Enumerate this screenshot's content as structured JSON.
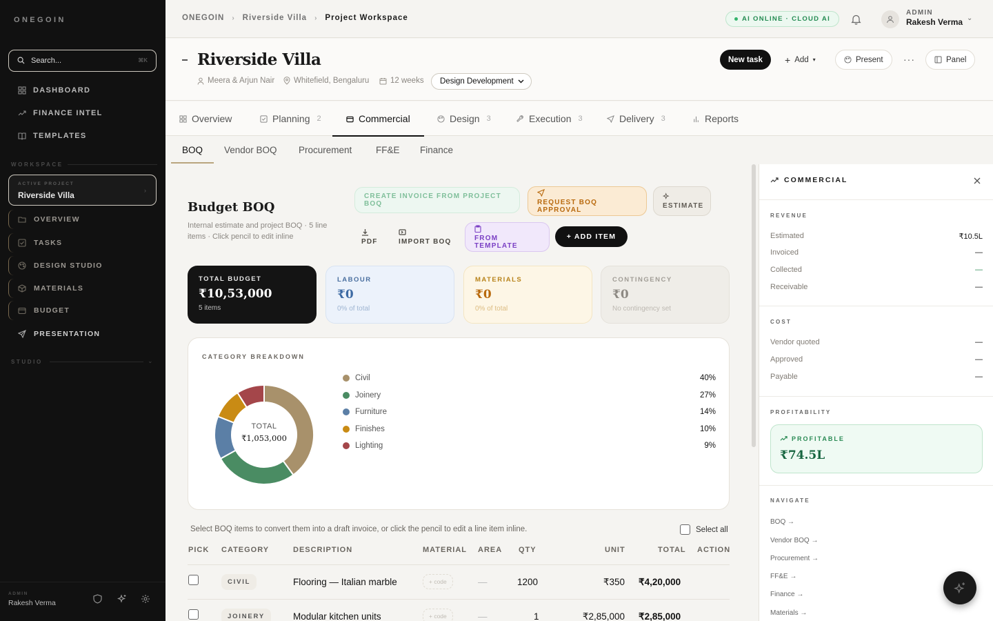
{
  "sidebar": {
    "brand": "ONEGOIN",
    "search_placeholder": "Search...",
    "search_shortcut": "⌘K",
    "top_nav": [
      {
        "label": "DASHBOARD",
        "icon": "grid-icon"
      },
      {
        "label": "FINANCE INTEL",
        "icon": "trend-icon"
      },
      {
        "label": "TEMPLATES",
        "icon": "book-icon"
      }
    ],
    "workspace_label": "WORKSPACE",
    "active_project_label": "ACTIVE PROJECT",
    "active_project": "Riverside Villa",
    "project_nav": [
      {
        "label": "OVERVIEW",
        "icon": "folder-icon"
      },
      {
        "label": "TASKS",
        "icon": "check-square-icon"
      },
      {
        "label": "DESIGN STUDIO",
        "icon": "palette-icon"
      },
      {
        "label": "MATERIALS",
        "icon": "box-icon"
      },
      {
        "label": "BUDGET",
        "icon": "wallet-icon"
      },
      {
        "label": "PRESENTATION",
        "icon": "send-icon"
      }
    ],
    "studio_label": "STUDIO",
    "footer": {
      "role": "ADMIN",
      "name": "Rakesh Verma"
    }
  },
  "header": {
    "breadcrumb": [
      "ONEGOIN",
      "Riverside Villa",
      "Project Workspace"
    ],
    "ai_status": "AI ONLINE · CLOUD AI",
    "user_role": "ADMIN",
    "user_name": "Rakesh Verma"
  },
  "project": {
    "title": "Riverside Villa",
    "client": "Meera & Arjun Nair",
    "location": "Whitefield, Bengaluru",
    "duration": "12 weeks",
    "phase": "Design Development",
    "actions": {
      "new_task": "New task",
      "add": "Add",
      "present": "Present",
      "panel": "Panel"
    }
  },
  "tabs": [
    {
      "label": "Overview",
      "count": ""
    },
    {
      "label": "Planning",
      "count": "2"
    },
    {
      "label": "Commercial",
      "count": ""
    },
    {
      "label": "Design",
      "count": "3"
    },
    {
      "label": "Execution",
      "count": "3"
    },
    {
      "label": "Delivery",
      "count": "3"
    },
    {
      "label": "Reports",
      "count": ""
    }
  ],
  "subtabs": [
    "BOQ",
    "Vendor BOQ",
    "Procurement",
    "FF&E",
    "Finance"
  ],
  "boq": {
    "title": "Budget BOQ",
    "description": "Internal estimate and project BOQ · 5 line items · Click pencil to edit inline",
    "actions": {
      "create_invoice": "CREATE INVOICE FROM PROJECT BOQ",
      "request_approval": "REQUEST BOQ APPROVAL",
      "estimate": "ESTIMATE",
      "pdf": "PDF",
      "import": "IMPORT BOQ",
      "from_template": "FROM TEMPLATE",
      "add_item": "+ ADD ITEM"
    },
    "kpis": [
      {
        "label": "TOTAL BUDGET",
        "value": "₹10,53,000",
        "sub": "5 items"
      },
      {
        "label": "LABOUR",
        "value": "₹0",
        "sub": "0% of total"
      },
      {
        "label": "MATERIALS",
        "value": "₹0",
        "sub": "0% of total"
      },
      {
        "label": "CONTINGENCY",
        "value": "₹0",
        "sub": "No contingency set"
      }
    ],
    "hint": "Select BOQ items to convert them into a draft invoice, or click the pencil to edit a line item inline.",
    "select_all": "Select all",
    "columns": [
      "PICK",
      "CATEGORY",
      "DESCRIPTION",
      "MATERIAL",
      "AREA",
      "QTY",
      "UNIT",
      "TOTAL",
      "ACTION"
    ],
    "rows": [
      {
        "category": "CIVIL",
        "description": "Flooring — Italian marble",
        "material": "+ code",
        "area": "—",
        "qty": "1200",
        "unit": "₹350",
        "total": "₹4,20,000"
      },
      {
        "category": "JOINERY",
        "description": "Modular kitchen units",
        "material": "+ code",
        "area": "—",
        "qty": "1",
        "unit": "₹2,85,000",
        "total": "₹2,85,000"
      }
    ]
  },
  "chart_data": {
    "type": "pie",
    "title": "CATEGORY BREAKDOWN",
    "center_label": "TOTAL",
    "center_value": "₹1,053,000",
    "categories": [
      "Civil",
      "Joinery",
      "Furniture",
      "Finishes",
      "Lighting"
    ],
    "values": [
      40,
      27,
      14,
      10,
      9
    ],
    "labels": [
      "40%",
      "27%",
      "14%",
      "10%",
      "9%"
    ],
    "colors": [
      "#a8916b",
      "#4a8c63",
      "#5b7fa6",
      "#c98b14",
      "#a4464a"
    ],
    "donut": true,
    "legend": "right"
  },
  "panel": {
    "title": "COMMERCIAL",
    "revenue_label": "REVENUE",
    "revenue": [
      {
        "label": "Estimated",
        "value": "₹10.5L"
      },
      {
        "label": "Invoiced",
        "value": "—"
      },
      {
        "label": "Collected",
        "value": "—"
      },
      {
        "label": "Receivable",
        "value": "—"
      }
    ],
    "cost_label": "COST",
    "cost": [
      {
        "label": "Vendor quoted",
        "value": "—"
      },
      {
        "label": "Approved",
        "value": "—"
      },
      {
        "label": "Payable",
        "value": "—"
      }
    ],
    "profitability_label": "PROFITABILITY",
    "profit_status": "PROFITABLE",
    "profit_value": "₹74.5L",
    "navigate_label": "NAVIGATE",
    "navigate": [
      "BOQ →",
      "Vendor BOQ →",
      "Procurement →",
      "FF&E →",
      "Finance →",
      "Materials →"
    ]
  },
  "colors": {
    "accent_dark": "#111111",
    "gold": "#b9a57e",
    "green": "#2a8a54",
    "amber": "#b8690d",
    "purple": "#7a3fc4"
  }
}
